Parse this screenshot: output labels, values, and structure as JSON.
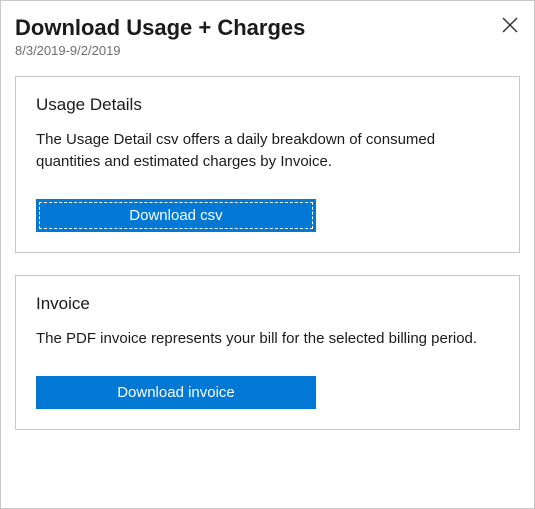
{
  "header": {
    "title": "Download Usage + Charges",
    "date_range": "8/3/2019-9/2/2019"
  },
  "cards": {
    "usage": {
      "title": "Usage Details",
      "description": "The Usage Detail csv offers a daily breakdown of consumed quantities and estimated charges by Invoice.",
      "button_label": "Download csv"
    },
    "invoice": {
      "title": "Invoice",
      "description": "The PDF invoice represents your bill for the selected billing period.",
      "button_label": "Download invoice"
    }
  },
  "colors": {
    "primary": "#0078d4"
  }
}
